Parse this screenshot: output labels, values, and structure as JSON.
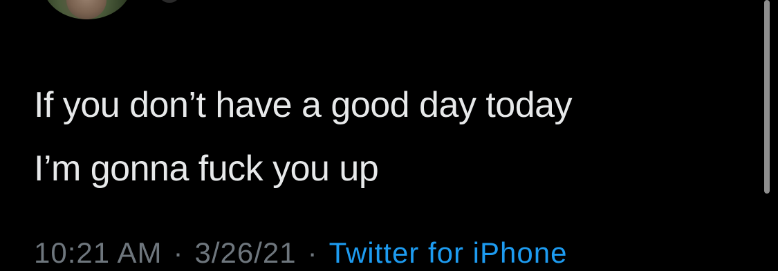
{
  "tweet": {
    "text_lines": [
      "If you don’t have a good day today",
      "I’m gonna fuck you up"
    ],
    "time": "10:21 AM",
    "separator": "·",
    "date": "3/26/21",
    "source": "Twitter for iPhone"
  },
  "colors": {
    "background": "#000000",
    "text": "#e7e9ea",
    "meta": "#6e767d",
    "link": "#1d9bf0"
  }
}
